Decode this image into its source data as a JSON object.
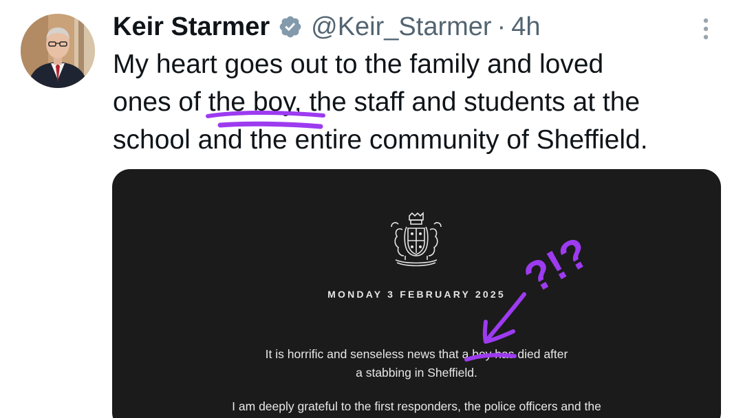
{
  "tweet": {
    "author": {
      "name": "Keir Starmer",
      "handle": "@Keir_Starmer",
      "verified_icon": "verified-badge-icon",
      "avatar": "profile photo of a man in a dark suit and red tie"
    },
    "separator": "·",
    "time": "4h",
    "more_icon": "more-vertical-icon",
    "text_lines": [
      "My heart goes out to the family and loved",
      "ones of the boy, the staff and students at the",
      "school and the entire community of Sheffield."
    ],
    "media": {
      "crest": "royal-coat-of-arms-icon",
      "date": "MONDAY 3 FEBRUARY 2025",
      "lines": [
        "It is horrific and senseless news that a boy has died after",
        "a stabbing in Sheffield.",
        "I am deeply grateful to the first responders, the police officers and the"
      ]
    }
  },
  "annotation": {
    "text": "?!?",
    "color": "#9d3bf0"
  },
  "colors": {
    "text": "#0f1419",
    "secondary": "#536471",
    "verified": "#829aab",
    "media_bg": "#1b1b1b",
    "annotation": "#9d3bf0"
  }
}
